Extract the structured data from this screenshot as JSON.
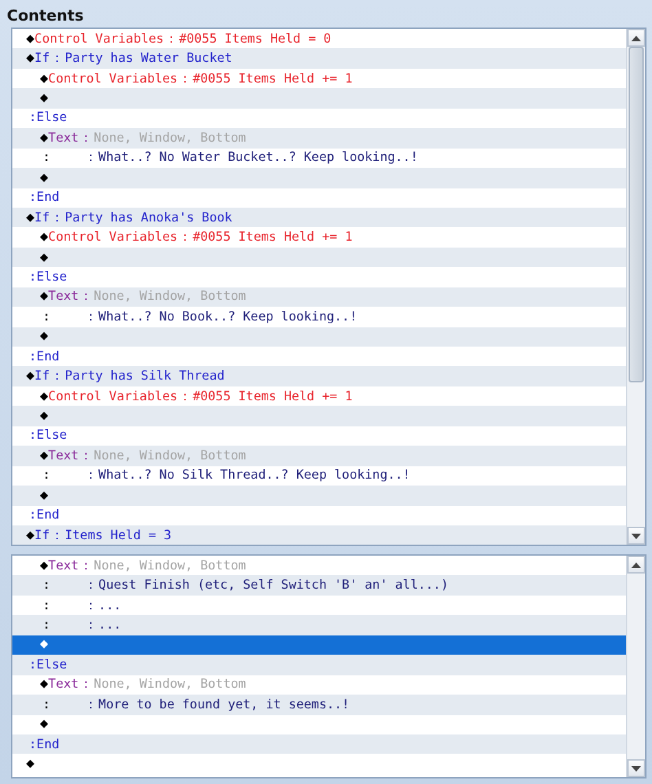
{
  "title": "Contents",
  "panes": [
    {
      "rows": [
        {
          "kind": "control",
          "marker": "◆",
          "command": "Control Variables",
          "separator": "：",
          "params": "#0055 Items Held = 0",
          "selected": false
        },
        {
          "kind": "branch",
          "marker": "◆",
          "command": "If",
          "separator": "：",
          "params": "Party has Water Bucket",
          "selected": false,
          "children": [
            {
              "kind": "control",
              "marker": "◆",
              "command": "Control Variables",
              "separator": "：",
              "params": "#0055 Items Held += 1",
              "selected": false
            },
            {
              "kind": "empty",
              "marker": "◆",
              "selected": false
            }
          ]
        },
        {
          "kind": "else",
          "marker": ":",
          "command": "Else",
          "selected": false,
          "children": [
            {
              "kind": "text",
              "marker": "◆",
              "command": "Text",
              "separator": "：",
              "params": "None, Window, Bottom",
              "selected": false
            },
            {
              "kind": "message",
              "marker": ":",
              "separator": "：",
              "params": "What..? No Water Bucket..? Keep looking..!",
              "selected": false
            },
            {
              "kind": "empty",
              "marker": "◆",
              "selected": false
            }
          ]
        },
        {
          "kind": "end",
          "marker": ":",
          "command": "End",
          "selected": false
        },
        {
          "kind": "branch",
          "marker": "◆",
          "command": "If",
          "separator": "：",
          "params": "Party has Anoka's Book",
          "selected": false,
          "children": [
            {
              "kind": "control",
              "marker": "◆",
              "command": "Control Variables",
              "separator": "：",
              "params": "#0055 Items Held += 1",
              "selected": false
            },
            {
              "kind": "empty",
              "marker": "◆",
              "selected": false
            }
          ]
        },
        {
          "kind": "else",
          "marker": ":",
          "command": "Else",
          "selected": false,
          "children": [
            {
              "kind": "text",
              "marker": "◆",
              "command": "Text",
              "separator": "：",
              "params": "None, Window, Bottom",
              "selected": false
            },
            {
              "kind": "message",
              "marker": ":",
              "separator": "：",
              "params": "What..? No Book..? Keep looking..!",
              "selected": false
            },
            {
              "kind": "empty",
              "marker": "◆",
              "selected": false
            }
          ]
        },
        {
          "kind": "end",
          "marker": ":",
          "command": "End",
          "selected": false
        },
        {
          "kind": "branch",
          "marker": "◆",
          "command": "If",
          "separator": "：",
          "params": "Party has Silk Thread",
          "selected": false,
          "children": [
            {
              "kind": "control",
              "marker": "◆",
              "command": "Control Variables",
              "separator": "：",
              "params": "#0055 Items Held += 1",
              "selected": false
            },
            {
              "kind": "empty",
              "marker": "◆",
              "selected": false
            }
          ]
        },
        {
          "kind": "else",
          "marker": ":",
          "command": "Else",
          "selected": false,
          "children": [
            {
              "kind": "text",
              "marker": "◆",
              "command": "Text",
              "separator": "：",
              "params": "None, Window, Bottom",
              "selected": false
            },
            {
              "kind": "message",
              "marker": ":",
              "separator": "：",
              "params": "What..? No Silk Thread..? Keep looking..!",
              "selected": false
            },
            {
              "kind": "empty",
              "marker": "◆",
              "selected": false
            }
          ]
        },
        {
          "kind": "end",
          "marker": ":",
          "command": "End",
          "selected": false
        },
        {
          "kind": "branch",
          "marker": "◆",
          "command": "If",
          "separator": "：",
          "params": "Items Held = 3",
          "selected": false
        }
      ]
    },
    {
      "rows": [
        {
          "kind": "continued",
          "children": [
            {
              "kind": "text",
              "marker": "◆",
              "command": "Text",
              "separator": "：",
              "params": "None, Window, Bottom",
              "selected": false
            },
            {
              "kind": "message",
              "marker": ":",
              "separator": "：",
              "params": "Quest Finish (etc, Self Switch 'B' an' all...)",
              "selected": false
            },
            {
              "kind": "message",
              "marker": ":",
              "separator": "：",
              "params": "...",
              "selected": false
            },
            {
              "kind": "message",
              "marker": ":",
              "separator": "：",
              "params": "...",
              "selected": false
            },
            {
              "kind": "empty",
              "marker": "◆",
              "selected": true
            }
          ]
        },
        {
          "kind": "else",
          "marker": ":",
          "command": "Else",
          "selected": false,
          "children": [
            {
              "kind": "text",
              "marker": "◆",
              "command": "Text",
              "separator": "：",
              "params": "None, Window, Bottom",
              "selected": false
            },
            {
              "kind": "message",
              "marker": ":",
              "separator": "：",
              "params": "More to be found yet, it seems..!",
              "selected": false
            },
            {
              "kind": "empty",
              "marker": "◆",
              "selected": false
            }
          ]
        },
        {
          "kind": "end",
          "marker": ":",
          "command": "End",
          "selected": false
        },
        {
          "kind": "empty",
          "marker": "◆",
          "selected": false
        }
      ]
    }
  ]
}
